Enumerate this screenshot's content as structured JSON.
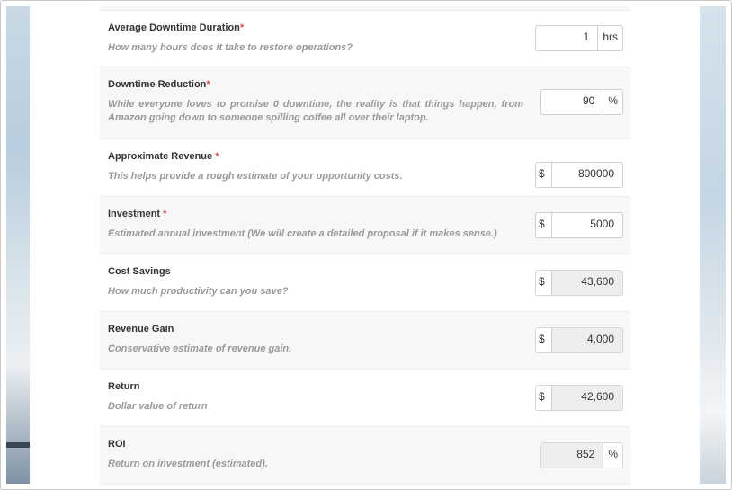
{
  "rows": [
    {
      "label": "Average Downtime Duration",
      "required": "*",
      "help": "How many hours does it take to restore operations?",
      "value": "1",
      "suffix": "hrs"
    },
    {
      "label": "Downtime Reduction",
      "required": "*",
      "help": "While everyone loves to promise 0 downtime, the reality is that things happen, from Amazon going down to someone spilling coffee all over their laptop.",
      "value": "90",
      "suffix": "%"
    },
    {
      "label": "Approximate Revenue ",
      "required": "*",
      "help": "This helps provide a rough estimate of your opportunity costs.",
      "prefix": "$",
      "value": "800000"
    },
    {
      "label": "Investment ",
      "required": "*",
      "help": "Estimated annual investment (We will create a detailed proposal if it makes sense.)",
      "prefix": "$",
      "value": "5000"
    },
    {
      "label": "Cost Savings",
      "help": "How much productivity can you save?",
      "prefix": "$",
      "value": "43,600"
    },
    {
      "label": "Revenue Gain",
      "help": "Conservative estimate of revenue gain.",
      "prefix": "$",
      "value": "4,000"
    },
    {
      "label": "Return",
      "help": "Dollar value of return",
      "prefix": "$",
      "value": "42,600"
    },
    {
      "label": "ROI",
      "help": "Return on investment (estimated).",
      "value": "852",
      "suffix": "%"
    }
  ]
}
